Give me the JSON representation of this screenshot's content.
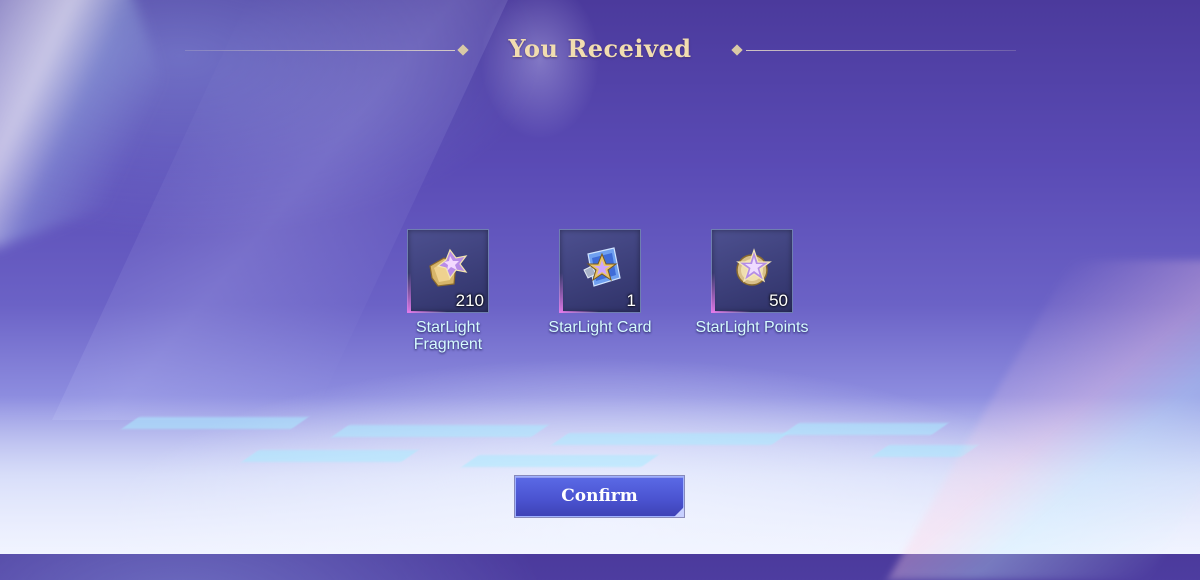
{
  "header": {
    "title": "You Received"
  },
  "rewards": [
    {
      "name": "StarLight Fragment",
      "quantity": "210",
      "icon": "starlight-fragment-icon"
    },
    {
      "name": "StarLight Card",
      "quantity": "1",
      "icon": "starlight-card-icon"
    },
    {
      "name": "StarLight Points",
      "quantity": "50",
      "icon": "starlight-points-icon"
    }
  ],
  "actions": {
    "confirm_label": "Confirm"
  },
  "colors": {
    "title": "#f1ddb0",
    "label": "#d6fbff",
    "button": "#4a52cf"
  }
}
